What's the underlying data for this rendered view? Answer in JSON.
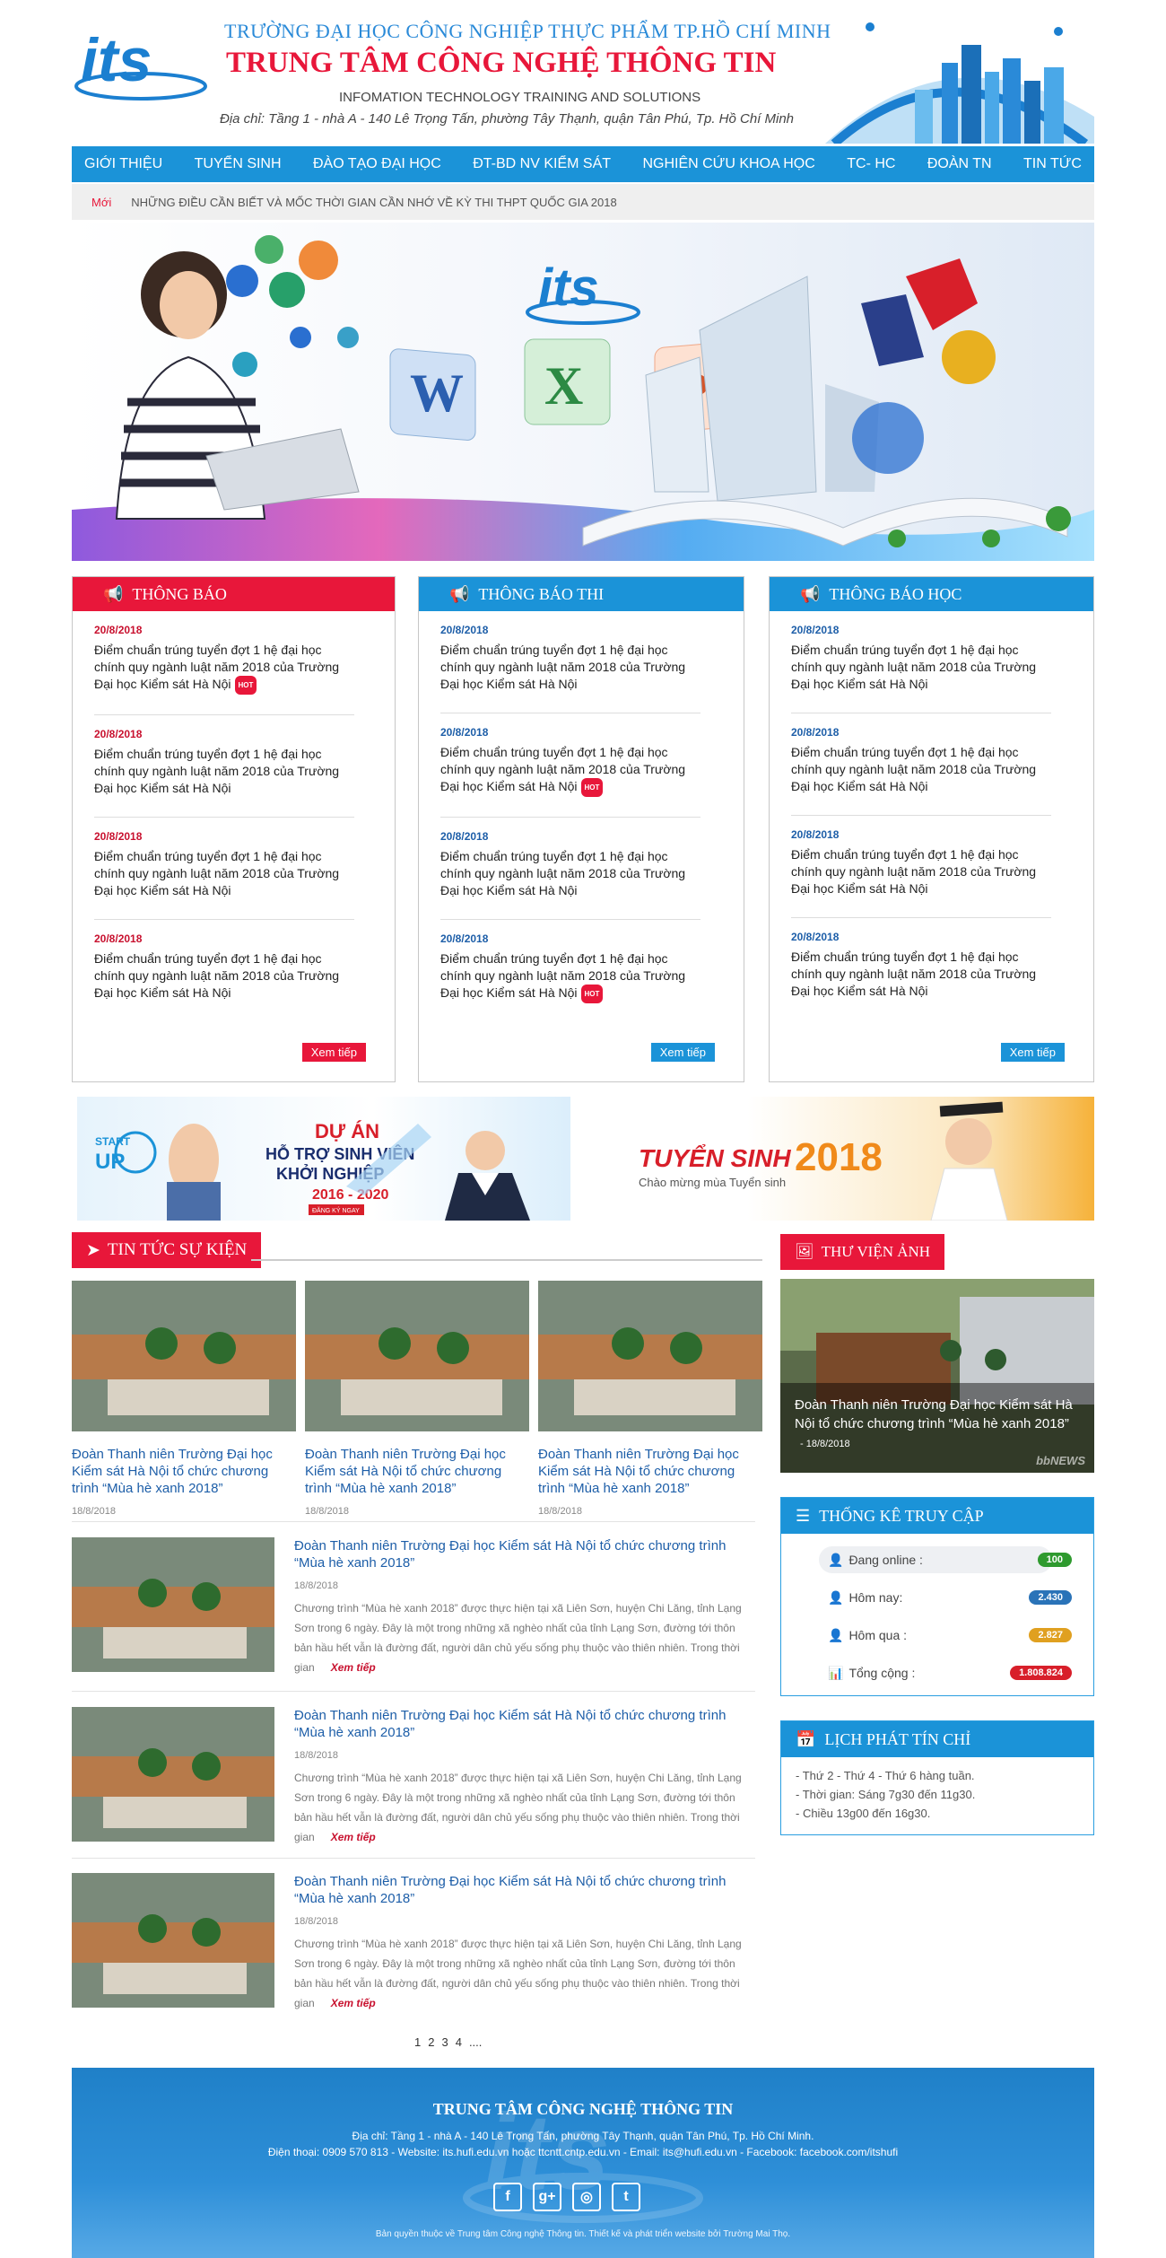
{
  "header": {
    "school": "TRƯỜNG ĐẠI HỌC CÔNG NGHIỆP THỰC PHẨM TP.HỒ CHÍ MINH",
    "center": "TRUNG TÂM CÔNG NGHỆ THÔNG TIN",
    "english": "INFOMATION TECHNOLOGY TRAINING AND SOLUTIONS",
    "address": "Địa chỉ: Tầng 1 - nhà A - 140 Lê Trọng Tấn, phường Tây Thạnh, quận Tân Phú, Tp. Hồ Chí Minh",
    "logo_text": "its"
  },
  "nav": [
    "GIỚI THIỆU",
    "TUYỂN SINH",
    "ĐÀO TẠO ĐẠI HỌC",
    "ĐT-BD NV KIỂM SÁT",
    "NGHIÊN CỨU KHOA HỌC",
    "TC- HC",
    "ĐOÀN TN",
    "TIN TỨC"
  ],
  "ticker": {
    "label": "Mới",
    "text": "NHỮNG ĐIỀU CẦN BIẾT VÀ MỐC THỜI GIAN CẦN NHỚ VỀ KỲ THI THPT QUỐC GIA 2018"
  },
  "banner": {
    "logo_text": "its"
  },
  "notices": [
    {
      "title": "THÔNG BÁO",
      "color": "#e8173a",
      "date_color": "#c8102e",
      "more": "Xem tiếp",
      "items": [
        {
          "date": "20/8/2018",
          "title": "Điểm chuẩn trúng tuyển đợt 1 hệ đại học chính quy ngành luật năm 2018 của Trường Đại học Kiểm sát Hà Nội",
          "hot": true
        },
        {
          "date": "20/8/2018",
          "title": "Điểm chuẩn trúng tuyển đợt 1 hệ đại học chính quy ngành luật năm 2018 của Trường Đại học Kiểm sát Hà Nội",
          "hot": false
        },
        {
          "date": "20/8/2018",
          "title": "Điểm chuẩn trúng tuyển đợt 1 hệ đại học chính quy ngành luật năm 2018 của Trường Đại học Kiểm sát Hà Nội",
          "hot": false
        },
        {
          "date": "20/8/2018",
          "title": "Điểm chuẩn trúng tuyển đợt 1 hệ đại học chính quy ngành luật năm 2018 của Trường Đại học Kiểm sát Hà Nội",
          "hot": false
        }
      ]
    },
    {
      "title": "THÔNG BÁO THI",
      "color": "#1b93d8",
      "date_color": "#1d5ea8",
      "more": "Xem tiếp",
      "items": [
        {
          "date": "20/8/2018",
          "title": "Điểm chuẩn trúng tuyển đợt 1 hệ đại học chính quy ngành luật năm 2018 của Trường Đại học Kiểm sát Hà Nội",
          "hot": false
        },
        {
          "date": "20/8/2018",
          "title": "Điểm chuẩn trúng tuyển đợt 1 hệ đại học chính quy ngành luật năm 2018 của Trường Đại học Kiểm sát Hà Nội",
          "hot": true
        },
        {
          "date": "20/8/2018",
          "title": "Điểm chuẩn trúng tuyển đợt 1 hệ đại học chính quy ngành luật năm 2018 của Trường Đại học Kiểm sát Hà Nội",
          "hot": false
        },
        {
          "date": "20/8/2018",
          "title": "Điểm chuẩn trúng tuyển đợt 1 hệ đại học chính quy ngành luật năm 2018 của Trường Đại học Kiểm sát Hà Nội",
          "hot": true
        }
      ]
    },
    {
      "title": "THÔNG BÁO HỌC",
      "color": "#1b93d8",
      "date_color": "#1d5ea8",
      "more": "Xem tiếp",
      "items": [
        {
          "date": "20/8/2018",
          "title": "Điểm chuẩn trúng tuyển đợt 1 hệ đại học chính quy ngành luật năm 2018 của Trường Đại học Kiểm sát Hà Nội",
          "hot": false
        },
        {
          "date": "20/8/2018",
          "title": "Điểm chuẩn trúng tuyển đợt 1 hệ đại học chính quy ngành luật năm 2018 của Trường Đại học Kiểm sát Hà Nội",
          "hot": false
        },
        {
          "date": "20/8/2018",
          "title": "Điểm chuẩn trúng tuyển đợt 1 hệ đại học chính quy ngành luật năm 2018 của Trường Đại học Kiểm sát Hà Nội",
          "hot": false
        },
        {
          "date": "20/8/2018",
          "title": "Điểm chuẩn trúng tuyển đợt 1 hệ đại học chính quy ngành luật năm 2018 của Trường Đại học Kiểm sát Hà Nội",
          "hot": false
        }
      ]
    }
  ],
  "hot_label": "HOT",
  "ads": {
    "left": {
      "start": "START",
      "up": "UP",
      "line1": "DỰ ÁN",
      "line2": "HỖ TRỢ SINH VIÊN",
      "line3": "KHỞI NGHIỆP",
      "years": "2016 - 2020",
      "button": "ĐĂNG KÝ NGAY"
    },
    "right": {
      "title": "TUYỂN SINH",
      "year": "2018",
      "sub": "Chào mừng mùa Tuyển sinh"
    }
  },
  "news_section": {
    "title": "TIN TỨC SỰ KIỆN"
  },
  "featured": [
    {
      "title": "Đoàn Thanh niên Trường Đại học Kiểm sát Hà Nội tổ chức chương trình “Mùa hè xanh 2018”",
      "date": "18/8/2018"
    },
    {
      "title": "Đoàn Thanh niên Trường Đại học Kiểm sát Hà Nội tổ chức chương trình “Mùa hè xanh 2018”",
      "date": "18/8/2018"
    },
    {
      "title": "Đoàn Thanh niên Trường Đại học Kiểm sát Hà Nội tổ chức chương trình “Mùa hè xanh 2018”",
      "date": "18/8/2018"
    }
  ],
  "news_list": [
    {
      "title": "Đoàn Thanh niên Trường Đại học Kiểm sát Hà Nội tổ chức chương trình “Mùa hè xanh 2018”",
      "date": "18/8/2018",
      "summary": "Chương trình “Mùa hè xanh 2018” được thực hiện tại xã Liên Sơn, huyện Chi Lăng, tỉnh Lạng Sơn trong 6 ngày. Đây là một trong những xã nghèo nhất của tỉnh Lạng Sơn, đường tới thôn bản hầu hết vẫn là đường đất, người dân chủ yếu sống phụ thuộc vào thiên nhiên. Trong thời gian",
      "more": "Xem tiếp"
    },
    {
      "title": "Đoàn Thanh niên Trường Đại học Kiểm sát Hà Nội tổ chức chương trình “Mùa hè xanh 2018”",
      "date": "18/8/2018",
      "summary": "Chương trình “Mùa hè xanh 2018” được thực hiện tại xã Liên Sơn, huyện Chi Lăng, tỉnh Lạng Sơn trong 6 ngày. Đây là một trong những xã nghèo nhất của tỉnh Lạng Sơn, đường tới thôn bản hầu hết vẫn là đường đất, người dân chủ yếu sống phụ thuộc vào thiên nhiên. Trong thời gian",
      "more": "Xem tiếp"
    },
    {
      "title": "Đoàn Thanh niên Trường Đại học Kiểm sát Hà Nội tổ chức chương trình “Mùa hè xanh 2018”",
      "date": "18/8/2018",
      "summary": "Chương trình “Mùa hè xanh 2018” được thực hiện tại xã Liên Sơn, huyện Chi Lăng, tỉnh Lạng Sơn trong 6 ngày. Đây là một trong những xã nghèo nhất của tỉnh Lạng Sơn, đường tới thôn bản hầu hết vẫn là đường đất, người dân chủ yếu sống phụ thuộc vào thiên nhiên. Trong thời gian",
      "more": "Xem tiếp"
    }
  ],
  "pager": [
    "1",
    "2",
    "3",
    "4",
    "...."
  ],
  "gallery": {
    "title": "THƯ VIỆN ẢNH",
    "caption": "Đoàn Thanh niên Trường Đại học Kiểm sát Hà Nội tổ chức chương trình “Mùa hè xanh 2018”",
    "date": "- 18/8/2018",
    "watermark": "bbNEWS"
  },
  "stats": {
    "title": "THỐNG KÊ TRUY CẬP",
    "rows": [
      {
        "label": "Đang online :",
        "value": "100",
        "color": "#2f9a2f",
        "icon": "user-icon"
      },
      {
        "label": "Hôm nay:",
        "value": "2.430",
        "color": "#2a73b8",
        "icon": "user-icon"
      },
      {
        "label": "Hôm qua :",
        "value": "2.827",
        "color": "#e0a020",
        "icon": "user-icon"
      },
      {
        "label": "Tổng cộng :",
        "value": "1.808.824",
        "color": "#d81f2a",
        "icon": "bar-chart-icon"
      }
    ]
  },
  "schedule": {
    "title": "LỊCH PHÁT TÍN CHỈ",
    "lines": [
      "- Thứ 2 - Thứ 4 - Thứ 6 hàng tuần.",
      "- Thời gian: Sáng 7g30 đến 11g30.",
      "- Chiều 13g00 đến 16g30."
    ]
  },
  "footer": {
    "title": "TRUNG TÂM CÔNG NGHỆ THÔNG TIN",
    "address": "Địa chỉ: Tầng 1 - nhà A - 140 Lê Trọng Tấn, phường Tây Thạnh, quận Tân Phú, Tp. Hồ Chí Minh.",
    "contact": "Điện thoại: 0909 570 813 - Website: its.hufi.edu.vn hoặc ttcntt.cntp.edu.vn - Email: its@hufi.edu.vn - Facebook: facebook.com/itshufi",
    "copyright": "Bản quyền thuộc về Trung tâm Công nghệ Thông tin. Thiết kế và phát triển website bởi Trường Mai Thọ.",
    "socials": [
      "f",
      "g+",
      "◎",
      "t"
    ]
  }
}
